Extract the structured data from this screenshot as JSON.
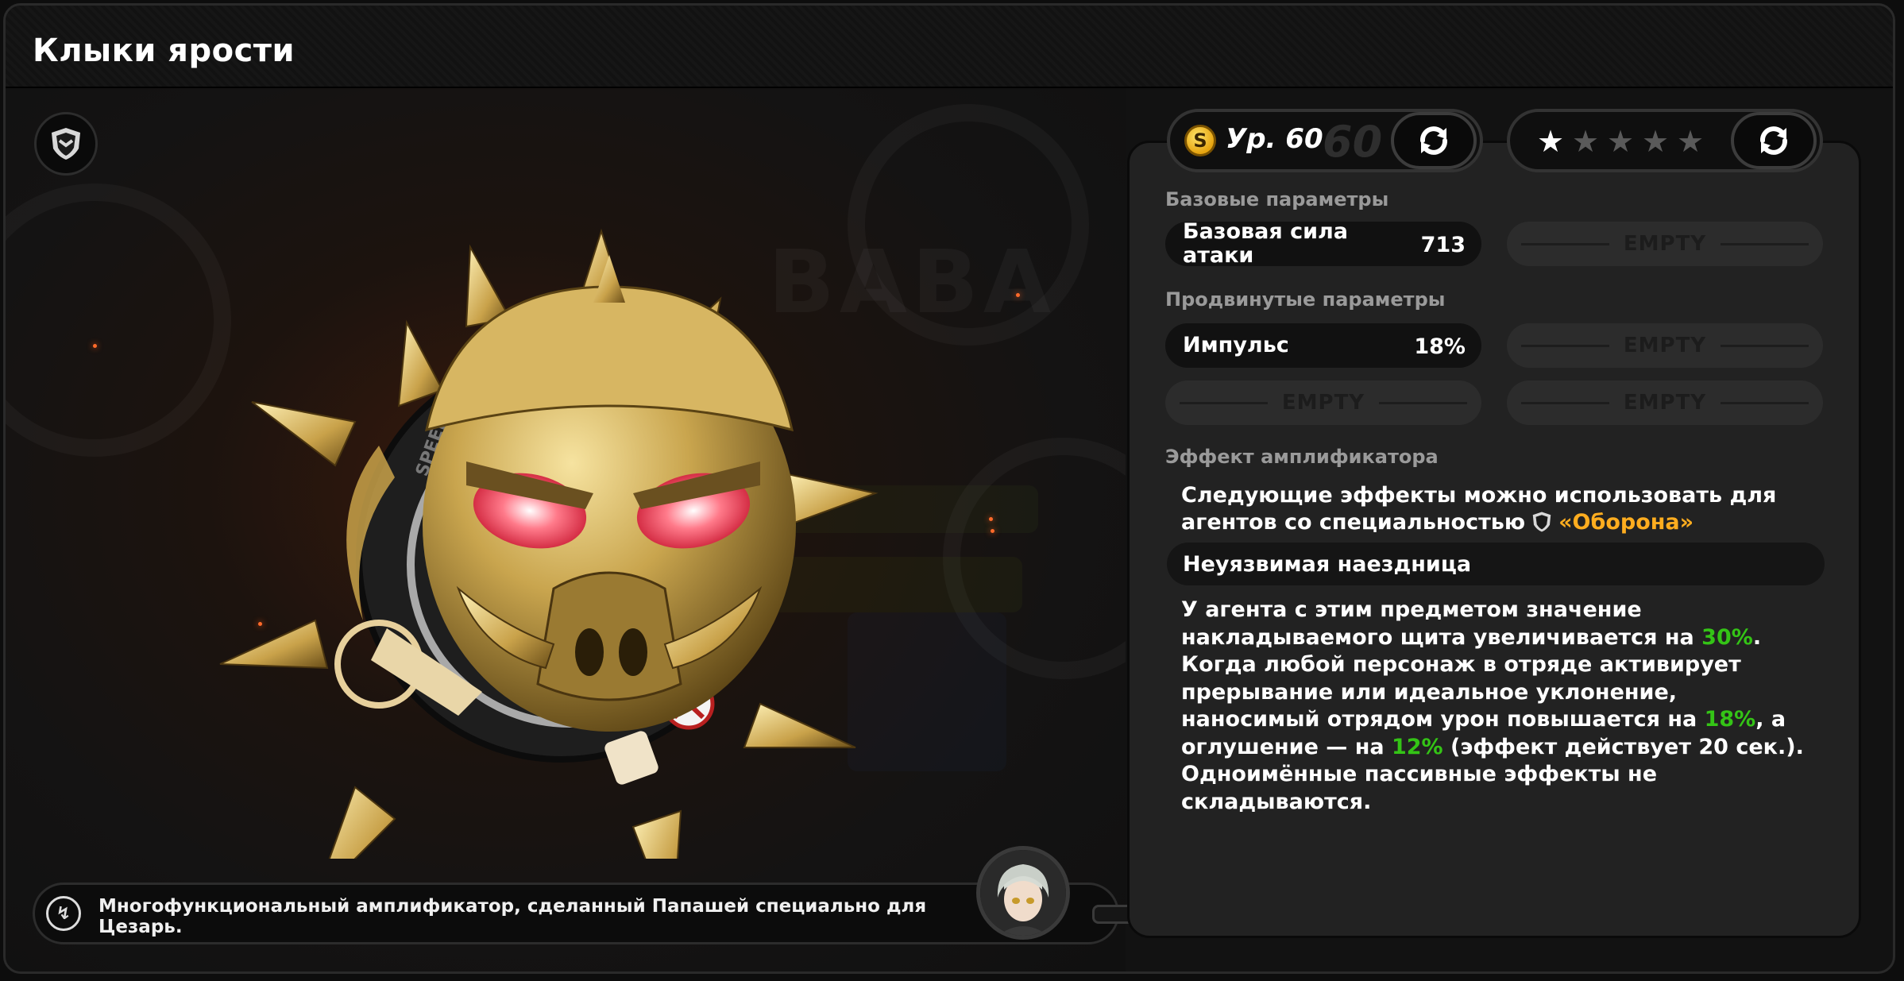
{
  "title": "Клыки ярости",
  "description": "Многофункциональный амплификатор, сделанный Папашей специально для Цезарь.",
  "level": {
    "rank": "S",
    "label": "Ур. 60",
    "max": "60"
  },
  "stars": {
    "filled": 1,
    "total": 5
  },
  "sections": {
    "base": "Базовые параметры",
    "advanced": "Продвинутые параметры",
    "effect": "Эффект амплификатора"
  },
  "base_stat": {
    "name": "Базовая сила атаки",
    "value": "713"
  },
  "advanced_stat": {
    "name": "Импульс",
    "value": "18%"
  },
  "empty_label": "EMPTY",
  "effect": {
    "intro": "Следующие эффекты можно использовать для агентов со специальностью",
    "specialty": "«Оборона»",
    "name": "Неуязвимая наездница",
    "body_parts": [
      "У агента с этим предметом значение накладываемого щита увеличивается на ",
      "30%",
      ". Когда любой персонаж в отряде активирует прерывание или идеальное уклонение, наносимый отрядом урон повышается на ",
      "18%",
      ", а оглушение — на ",
      "12%",
      " (эффект действует 20 сек.). Одноимённые пассивные эффекты не складываются."
    ]
  },
  "colors": {
    "highlight_green": "#34c416",
    "specialty_orange": "#ffad1f",
    "rank_gold": "#f0b41c"
  },
  "icons": {
    "specialty": "shield-icon",
    "refresh": "refresh-icon",
    "description": "amplifier-info-icon"
  }
}
